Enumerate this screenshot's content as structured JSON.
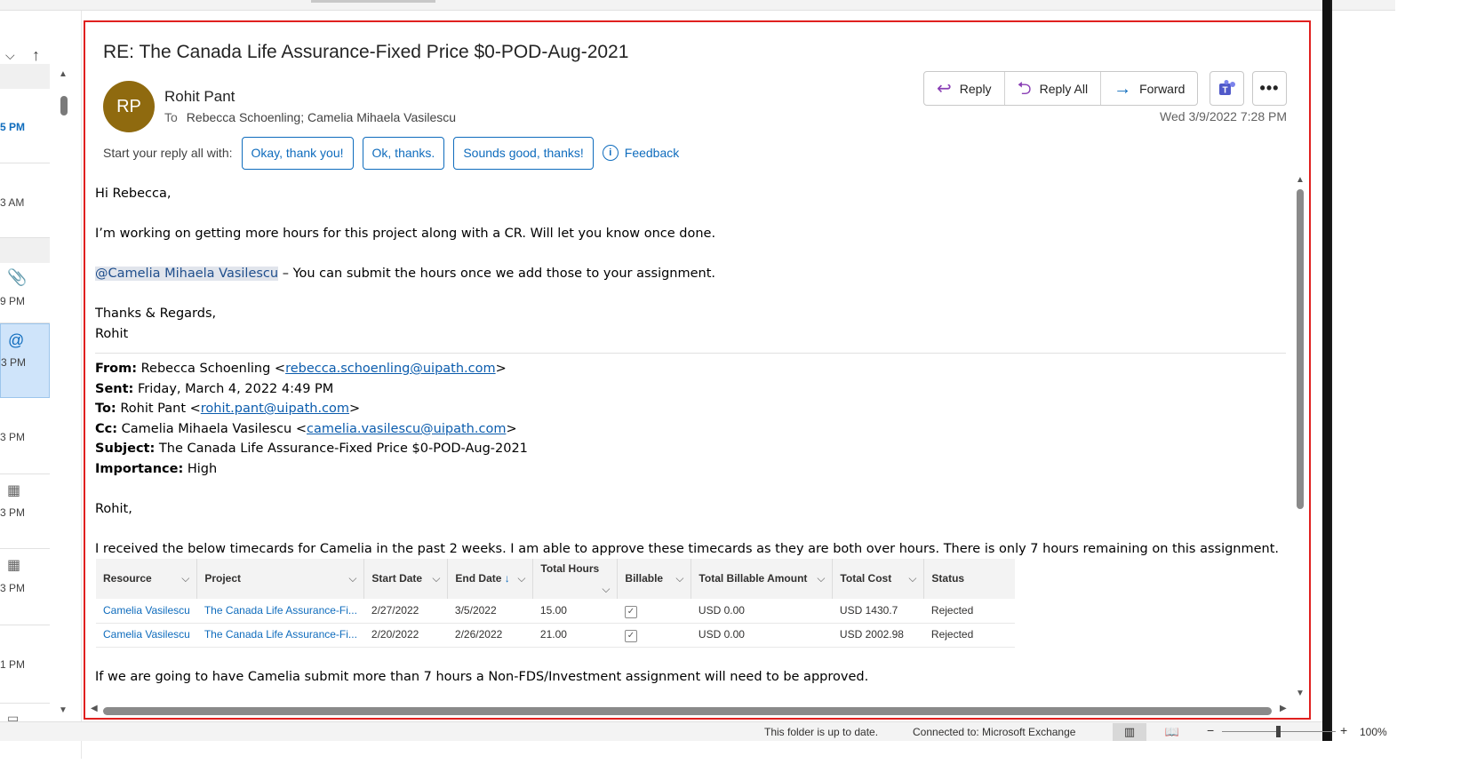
{
  "reading_pane": {
    "subject": "RE: The Canada Life Assurance-Fixed Price $0-POD-Aug-2021",
    "avatar_initials": "RP",
    "avatar_color": "#8f6a0f",
    "sender_name": "Rohit Pant",
    "to_label": "To",
    "recipients": "Rebecca Schoenling; Camelia Mihaela Vasilescu",
    "sent_datetime": "Wed 3/9/2022 7:28 PM",
    "actions": {
      "reply": "Reply",
      "reply_all": "Reply All",
      "forward": "Forward"
    },
    "quick_reply": {
      "label": "Start your reply all with:",
      "options": [
        "Okay, thank you!",
        "Ok, thanks.",
        "Sounds good, thanks!"
      ],
      "feedback": "Feedback"
    }
  },
  "body": {
    "greeting": "Hi Rebecca,",
    "line1": "I’m working on getting more hours for this project along with a CR. Will let you know once done.",
    "mention": "@Camelia Mihaela Vasilescu",
    "mention_rest": " – You can submit the hours once we add those to your assignment.",
    "signoff1": "Thanks & Regards,",
    "signoff2": "Rohit",
    "quoted": {
      "from_label": "From:",
      "from_name": " Rebecca Schoenling <",
      "from_email": "rebecca.schoenling@uipath.com",
      "sent_label": "Sent:",
      "sent_value": " Friday, March 4, 2022 4:49 PM",
      "to_label": "To:",
      "to_name": " Rohit Pant <",
      "to_email": "rohit.pant@uipath.com",
      "cc_label": "Cc:",
      "cc_name": " Camelia Mihaela Vasilescu <",
      "cc_email": "camelia.vasilescu@uipath.com",
      "subject_label": "Subject:",
      "subject_value": " The Canada Life Assurance-Fixed Price $0-POD-Aug-2021",
      "importance_label": "Importance:",
      "importance_value": " High",
      "greeting": "Rohit,",
      "para1": "I received the below timecards for Camelia in the past 2 weeks. I am able to approve these timecards as they are both over hours. There is only 7 hours remaining on this assignment.",
      "para2": "If we are going to have Camelia submit more than 7 hours a Non-FDS/Investment assignment will need to be approved."
    },
    "table": {
      "headers": [
        "Resource",
        "Project",
        "Start Date",
        "End Date",
        "Total Hours",
        "Billable",
        "Total Billable Amount",
        "Total Cost",
        "Status"
      ],
      "rows": [
        [
          "Camelia Vasilescu",
          "The Canada Life Assurance-Fi...",
          "2/27/2022",
          "3/5/2022",
          "15.00",
          "",
          "USD 0.00",
          "USD 1430.7",
          "Rejected"
        ],
        [
          "Camelia Vasilescu",
          "The Canada Life Assurance-Fi...",
          "2/20/2022",
          "2/26/2022",
          "21.00",
          "",
          "USD 0.00",
          "USD 2002.98",
          "Rejected"
        ]
      ]
    }
  },
  "message_list": {
    "times": [
      "5 PM",
      "3 AM",
      "9 PM",
      "3 PM",
      "3 PM",
      "3 PM",
      "3 PM",
      "1 PM"
    ]
  },
  "status_bar": {
    "folder_status": "This folder is up to date.",
    "connection": "Connected to: Microsoft Exchange",
    "zoom_minus": "−",
    "zoom_plus": "+",
    "zoom": "100%"
  },
  "colors": {
    "accent": "#0f6cbd",
    "highlight_border": "#e0201f",
    "reply_all_icon": "#8a3fb5"
  }
}
